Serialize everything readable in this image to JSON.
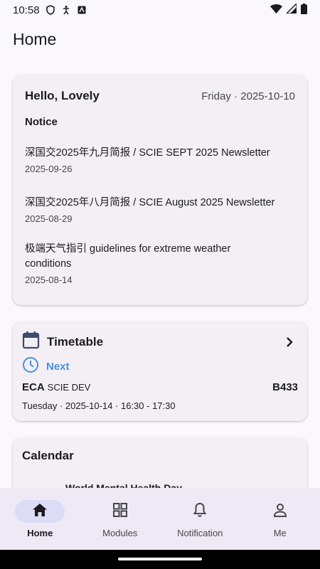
{
  "status_bar": {
    "time": "10:58"
  },
  "page": {
    "title": "Home"
  },
  "home_card": {
    "greeting": "Hello, Lovely",
    "date": "Friday · 2025-10-10",
    "notice_title": "Notice",
    "notices": [
      {
        "title": "深国交2025年九月简报 / SCIE SEPT 2025 Newsletter",
        "date": "2025-09-26"
      },
      {
        "title": "深国交2025年八月简报 / SCIE August 2025 Newsletter",
        "date": "2025-08-29"
      },
      {
        "title": "极端天气指引 guidelines for extreme weather conditions",
        "date": "2025-08-14"
      }
    ]
  },
  "timetable": {
    "title": "Timetable",
    "next_label": "Next",
    "class_code": "ECA",
    "class_group": "SCIE DEV",
    "room": "B433",
    "time": "Tuesday · 2025-10-14 · 16:30 - 17:30"
  },
  "calendar": {
    "title": "Calendar",
    "event": "World Mental Health Day"
  },
  "bottom_nav": {
    "items": [
      {
        "label": "Home",
        "icon": "home-icon",
        "active": true
      },
      {
        "label": "Modules",
        "icon": "grid-icon",
        "active": false
      },
      {
        "label": "Notification",
        "icon": "bell-icon",
        "active": false
      },
      {
        "label": "Me",
        "icon": "person-icon",
        "active": false
      }
    ]
  },
  "colors": {
    "background": "#fbf8fd",
    "card": "#f3eff5",
    "accent": "#4a8fd9",
    "nav_background": "#efe9f5",
    "nav_active_pill": "#dcdcf7",
    "icon_primary": "#3f4a6b"
  }
}
